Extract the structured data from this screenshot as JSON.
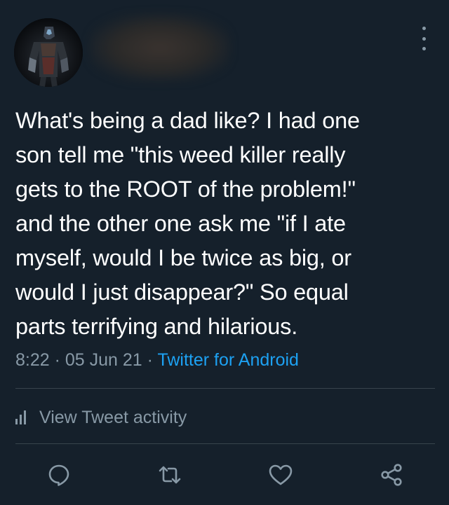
{
  "tweet": {
    "text": "What's being a dad like? I had one\nson tell me \"this weed killer really\ngets to the ROOT of the problem!\"\nand the other one ask me \"if I ate\nmyself, would I be twice as big, or\nwould I just disappear?\" So equal\nparts terrifying and hilarious.",
    "time": "8:22",
    "date": "05 Jun 21",
    "separator": " · ",
    "source": "Twitter for Android"
  },
  "activity": {
    "label": "View Tweet activity"
  },
  "icons": {
    "more": "more-vertical-icon",
    "reply": "reply-icon",
    "retweet": "retweet-icon",
    "like": "heart-icon",
    "share": "share-icon",
    "activity": "bar-chart-icon"
  },
  "colors": {
    "background": "#15202b",
    "text": "#ffffff",
    "secondary": "#8899a6",
    "link": "#1da1f2",
    "divider": "#38444d"
  }
}
